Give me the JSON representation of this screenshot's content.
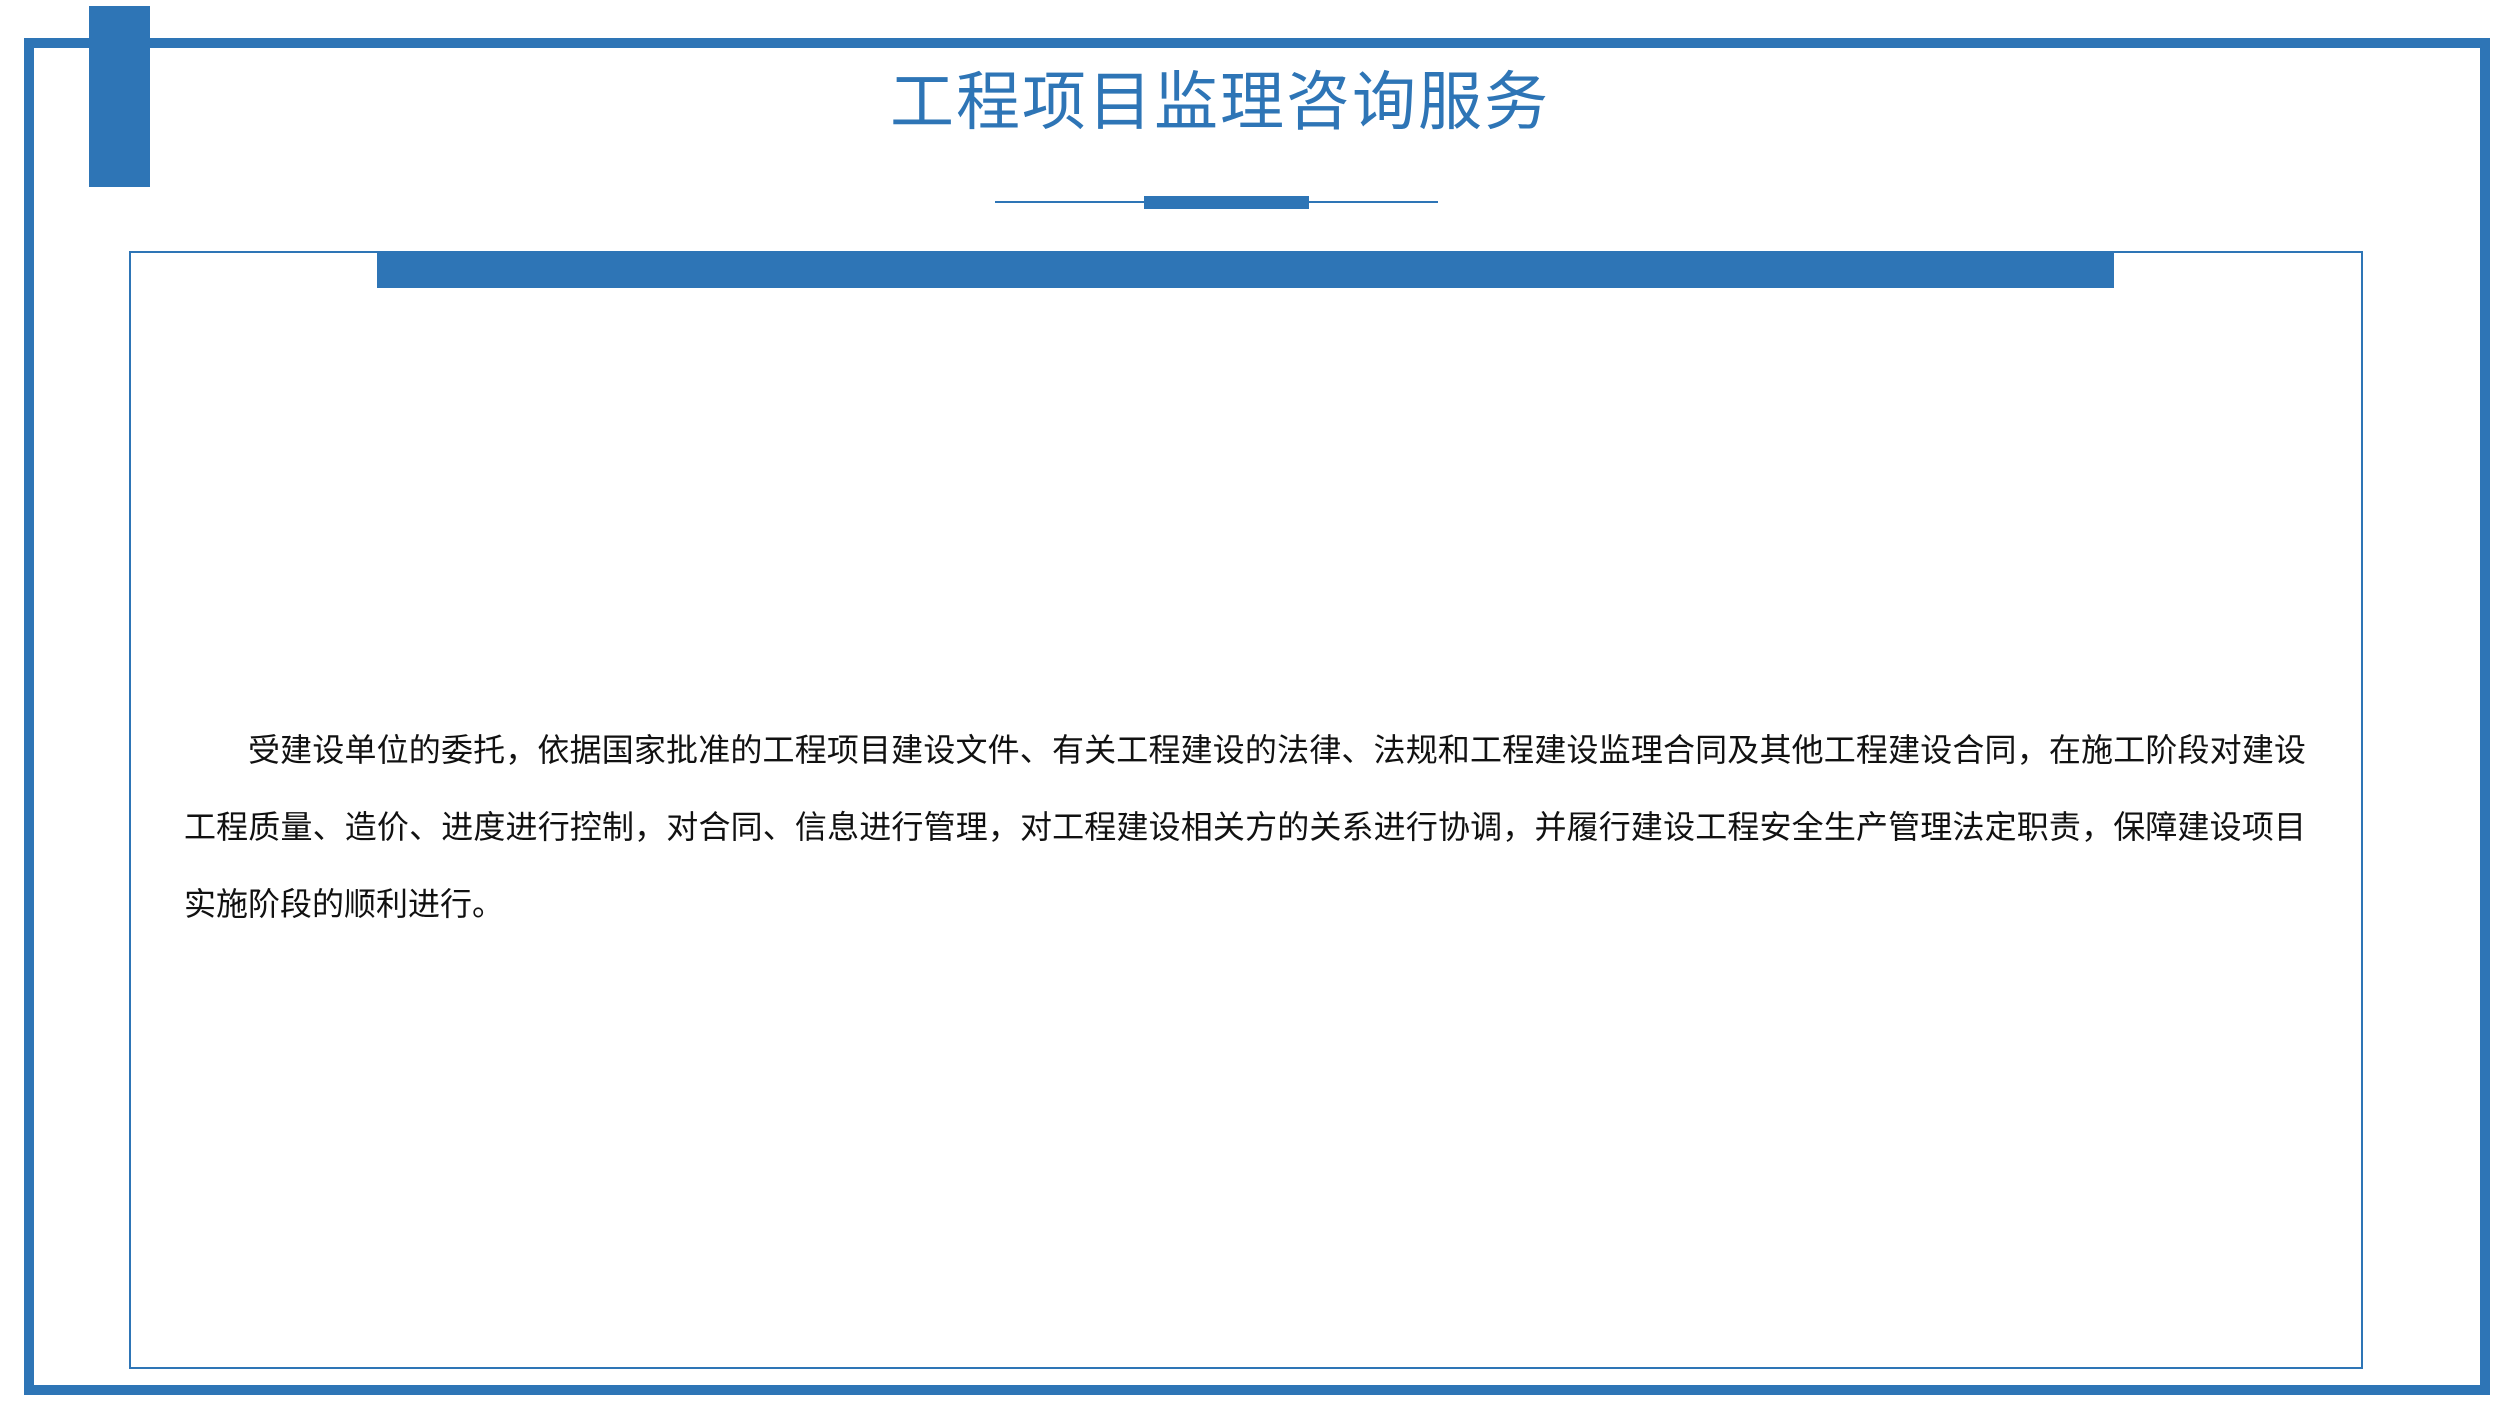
{
  "slide": {
    "title": "工程项目监理咨询服务",
    "body": "受建设单位的委托，依据国家批准的工程项目建设文件、有关工程建设的法律、法规和工程建设监理合同及其他工程建设合同，在施工阶段对建设工程质量、造价、进度进行控制，对合同、信息进行管理，对工程建设相关方的关系进行协调，并履行建设工程安全生产管理法定职责，保障建设项目实施阶段的顺利进行。"
  },
  "colors": {
    "accent": "#2e75b6",
    "text": "#111111",
    "background": "#ffffff"
  }
}
